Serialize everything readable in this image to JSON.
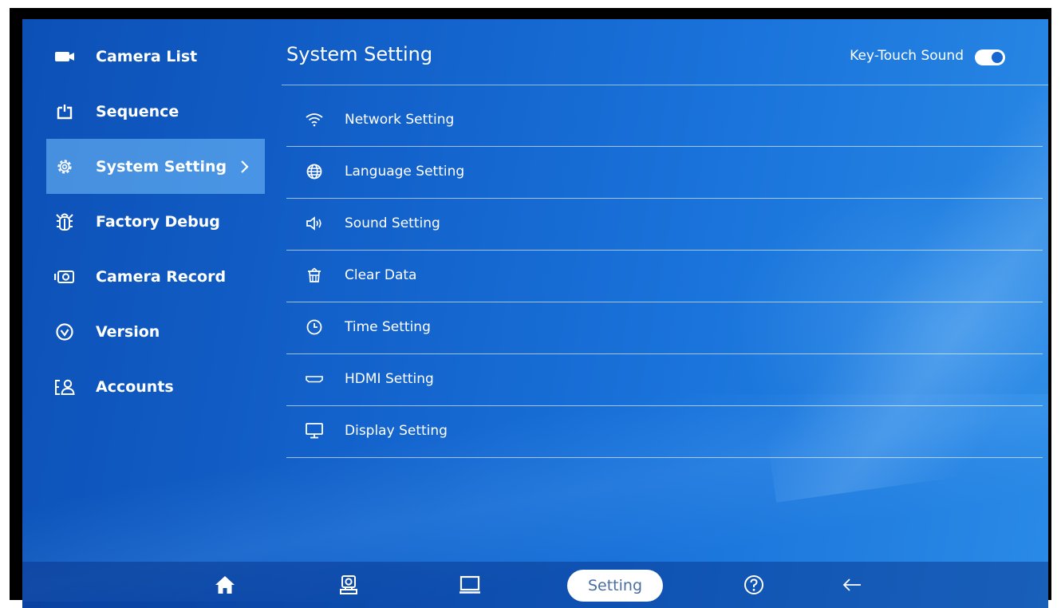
{
  "sidebar": {
    "items": [
      {
        "label": "Camera List",
        "icon": "camera-icon"
      },
      {
        "label": "Sequence",
        "icon": "sequence-icon"
      },
      {
        "label": "System Setting",
        "icon": "gear-icon",
        "active": true
      },
      {
        "label": "Factory Debug",
        "icon": "debug-bug-icon"
      },
      {
        "label": "Camera Record",
        "icon": "camera-record-icon"
      },
      {
        "label": "Version",
        "icon": "version-check-icon"
      },
      {
        "label": "Accounts",
        "icon": "accounts-icon"
      }
    ]
  },
  "header": {
    "title": "System Setting",
    "key_touch_sound_label": "Key-Touch Sound",
    "key_touch_sound_on": true
  },
  "settings": {
    "items": [
      {
        "label": "Network Setting",
        "icon": "wifi-icon"
      },
      {
        "label": "Language Setting",
        "icon": "globe-icon"
      },
      {
        "label": "Sound Setting",
        "icon": "speaker-icon"
      },
      {
        "label": "Clear Data",
        "icon": "trash-icon"
      },
      {
        "label": "Time Setting",
        "icon": "clock-icon"
      },
      {
        "label": "HDMI Setting",
        "icon": "hdmi-icon"
      },
      {
        "label": "Display Setting",
        "icon": "monitor-icon"
      }
    ]
  },
  "bottombar": {
    "items": [
      {
        "icon": "home-icon"
      },
      {
        "icon": "camera-mount-icon"
      },
      {
        "icon": "screen-icon"
      },
      {
        "label": "Setting",
        "active": true
      },
      {
        "icon": "help-icon"
      },
      {
        "icon": "back-arrow-icon"
      }
    ]
  },
  "colors": {
    "background_start": "#0c50b6",
    "background_end": "#2a8ae6",
    "active_item": "#78c3ff",
    "text": "#ffffff",
    "pill_text": "#4a6ea0"
  }
}
